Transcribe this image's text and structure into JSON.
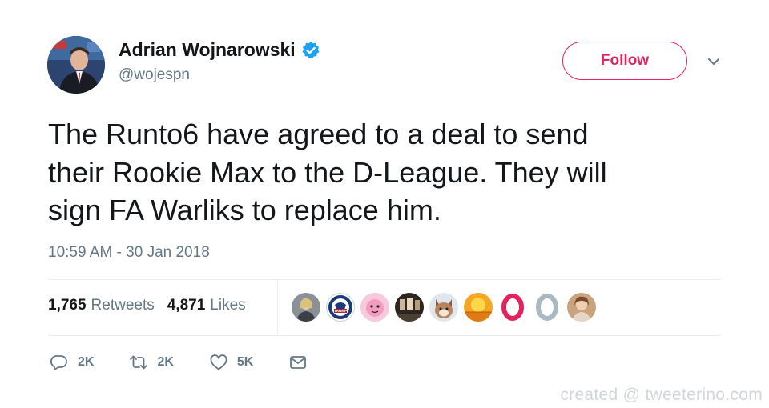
{
  "author": {
    "display_name": "Adrian Wojnarowski",
    "handle": "@wojespn",
    "verified": true
  },
  "follow_button": {
    "label": "Follow",
    "color": "#e0245e"
  },
  "tweet": {
    "lines": [
      "The Runto6 have agreed to a deal to send",
      "their Rookie Max to the D-League. They will",
      "sign FA Warliks to replace him."
    ],
    "timestamp": "10:59 AM - 30 Jan 2018"
  },
  "stats": {
    "retweets": {
      "count": "1,765",
      "label": "Retweets"
    },
    "likes": {
      "count": "4,871",
      "label": "Likes"
    }
  },
  "likers": [
    {
      "icon": "profile-photo"
    },
    {
      "icon": "trump-seal",
      "text": "TRUMP"
    },
    {
      "icon": "pink-character"
    },
    {
      "icon": "dark-portrait"
    },
    {
      "icon": "cat-mascot"
    },
    {
      "icon": "sunset-circle"
    },
    {
      "icon": "red-ring",
      "color": "#e0245e"
    },
    {
      "icon": "gray-ring",
      "color": "#aab8c2"
    },
    {
      "icon": "profile-photo-2"
    }
  ],
  "actions": {
    "reply": {
      "icon": "reply-icon",
      "count": "2K"
    },
    "retweet": {
      "icon": "retweet-icon",
      "count": "2K"
    },
    "like": {
      "icon": "heart-icon",
      "count": "5K"
    },
    "dm": {
      "icon": "envelope-icon"
    }
  },
  "watermark": "created @ tweeterino.com",
  "colors": {
    "text": "#14171a",
    "secondary": "#657786",
    "verified": "#1da1f2",
    "divider": "#e6ecf0"
  }
}
